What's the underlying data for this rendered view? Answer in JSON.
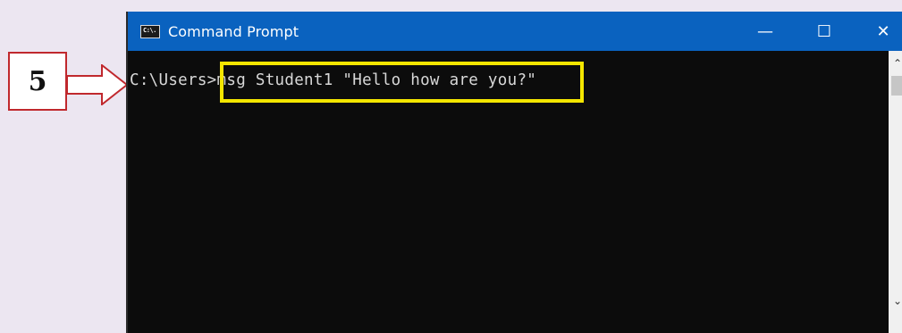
{
  "callout": {
    "step_number": "5",
    "border_color": "#c0282d"
  },
  "window": {
    "title": "Command Prompt",
    "app_icon_text": "C:\\.",
    "titlebar_color": "#0a62bf",
    "controls": {
      "minimize": "—",
      "maximize": "☐",
      "close": "✕"
    }
  },
  "console": {
    "prompt": "C:\\Users>",
    "command": "msg Student1 \"Hello how are you?\"",
    "highlight_color": "#f4e600"
  },
  "scrollbar": {
    "up_arrow": "⌃",
    "down_arrow": "⌄"
  }
}
